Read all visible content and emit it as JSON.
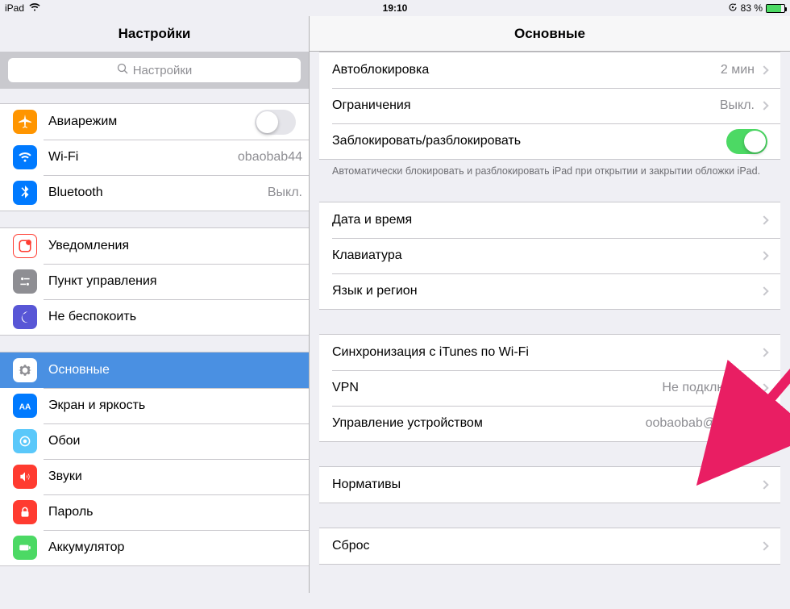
{
  "status_bar": {
    "device": "iPad",
    "time": "19:10",
    "battery_pct": "83 %"
  },
  "left": {
    "title": "Настройки",
    "search_placeholder": "Настройки",
    "g1": {
      "airplane": "Авиарежим",
      "wifi": "Wi-Fi",
      "wifi_value": "obaobab44",
      "bluetooth": "Bluetooth",
      "bluetooth_value": "Выкл."
    },
    "g2": {
      "notifications": "Уведомления",
      "control_center": "Пункт управления",
      "dnd": "Не беспокоить"
    },
    "g3": {
      "general": "Основные",
      "display": "Экран и яркость",
      "wallpaper": "Обои",
      "sounds": "Звуки",
      "passcode": "Пароль",
      "battery": "Аккумулятор"
    }
  },
  "right": {
    "title": "Основные",
    "g1": {
      "autolock": "Автоблокировка",
      "autolock_value": "2 мин",
      "restrictions": "Ограничения",
      "restrictions_value": "Выкл.",
      "lock_unlock": "Заблокировать/разблокировать"
    },
    "g1_footer": "Автоматически блокировать и разблокировать iPad при открытии и закрытии обложки iPad.",
    "g2": {
      "datetime": "Дата и время",
      "keyboard": "Клавиатура",
      "language": "Язык и регион"
    },
    "g3": {
      "itunes_wifi": "Синхронизация с iTunes по Wi-Fi",
      "vpn": "VPN",
      "vpn_value": "Не подключено",
      "profiles": "Управление устройством",
      "profiles_value": "oobaobab@mail.ru"
    },
    "g4": {
      "regulatory": "Нормативы"
    },
    "g5": {
      "reset": "Сброс"
    }
  }
}
